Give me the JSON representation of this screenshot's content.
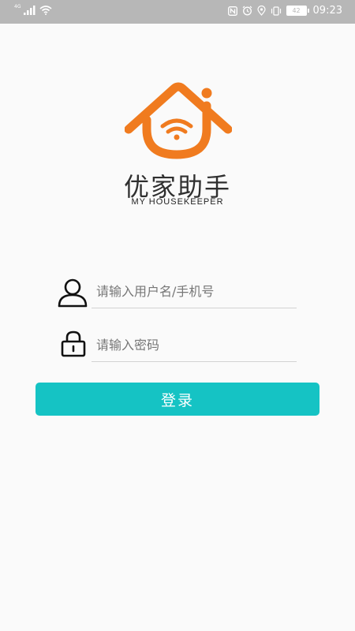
{
  "status_bar": {
    "network_label": "4G",
    "battery": "42",
    "time": "09:23",
    "icons": [
      "signal-icon",
      "wifi-icon",
      "nfc-icon",
      "alarm-icon",
      "location-icon",
      "vibrate-icon",
      "battery-icon"
    ]
  },
  "brand": {
    "name_cn": "优家助手",
    "name_en": "MY HOUSEKEEPER",
    "logo_color": "#f07b1f"
  },
  "form": {
    "username_placeholder": "请输入用户名/手机号",
    "username_value": "",
    "password_placeholder": "请输入密码",
    "password_value": "",
    "login_label": "登录",
    "accent_color": "#15c3c4"
  }
}
